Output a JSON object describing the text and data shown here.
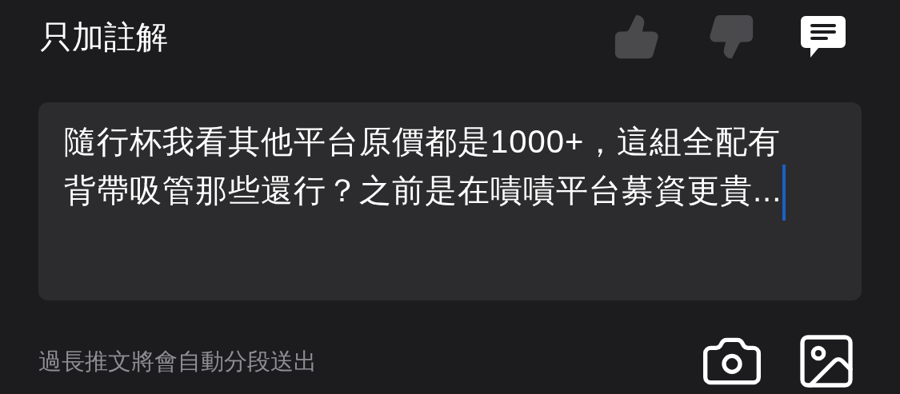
{
  "title": "只加註解",
  "modes": [
    {
      "kind": "like",
      "selected": false
    },
    {
      "kind": "dislike",
      "selected": false
    },
    {
      "kind": "comment",
      "selected": true
    }
  ],
  "comment_field": {
    "value": "隨行杯我看其他平台原價都是1000+，這組全配有背帶吸管那些還行？之前是在嘖嘖平台募資更貴..."
  },
  "hint": "過長推文將會自動分段送出"
}
